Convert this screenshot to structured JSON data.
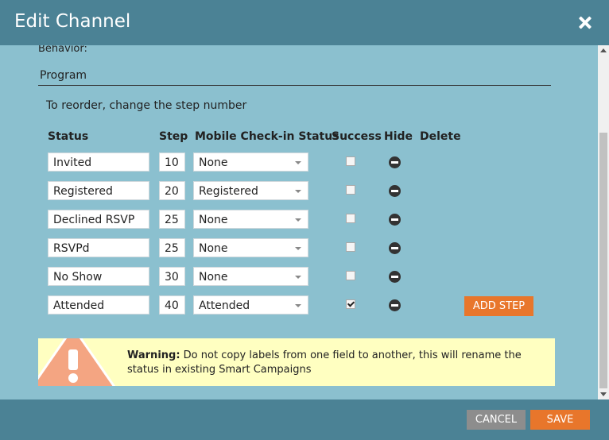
{
  "header": {
    "title": "Edit Channel",
    "close_icon": "close-icon"
  },
  "form": {
    "behavior_label": "Behavior:",
    "program_value": "Program",
    "reorder_hint": "To reorder, change the step number",
    "columns": {
      "status": "Status",
      "step": "Step",
      "mobile": "Mobile Check-in Status",
      "success": "Success",
      "hide": "Hide",
      "delete": "Delete"
    },
    "rows": [
      {
        "status": "Invited",
        "step": "10",
        "mobile": "None",
        "success": false
      },
      {
        "status": "Registered",
        "step": "20",
        "mobile": "Registered",
        "success": false
      },
      {
        "status": "Declined RSVP",
        "step": "25",
        "mobile": "None",
        "success": false
      },
      {
        "status": "RSVPd",
        "step": "25",
        "mobile": "None",
        "success": false
      },
      {
        "status": "No Show",
        "step": "30",
        "mobile": "None",
        "success": false
      },
      {
        "status": "Attended",
        "step": "40",
        "mobile": "Attended",
        "success": true
      }
    ],
    "add_step_label": "ADD STEP"
  },
  "warning": {
    "label": "Warning:",
    "message": "Do not copy labels from one field to another, this will rename the status in existing Smart Campaigns"
  },
  "footer": {
    "cancel_label": "CANCEL",
    "save_label": "SAVE"
  },
  "colors": {
    "header": "#4b8295",
    "body": "#8bc0cf",
    "accent": "#e8762b",
    "warning_bg": "#ffffc1",
    "warning_icon": "#f4a582"
  }
}
